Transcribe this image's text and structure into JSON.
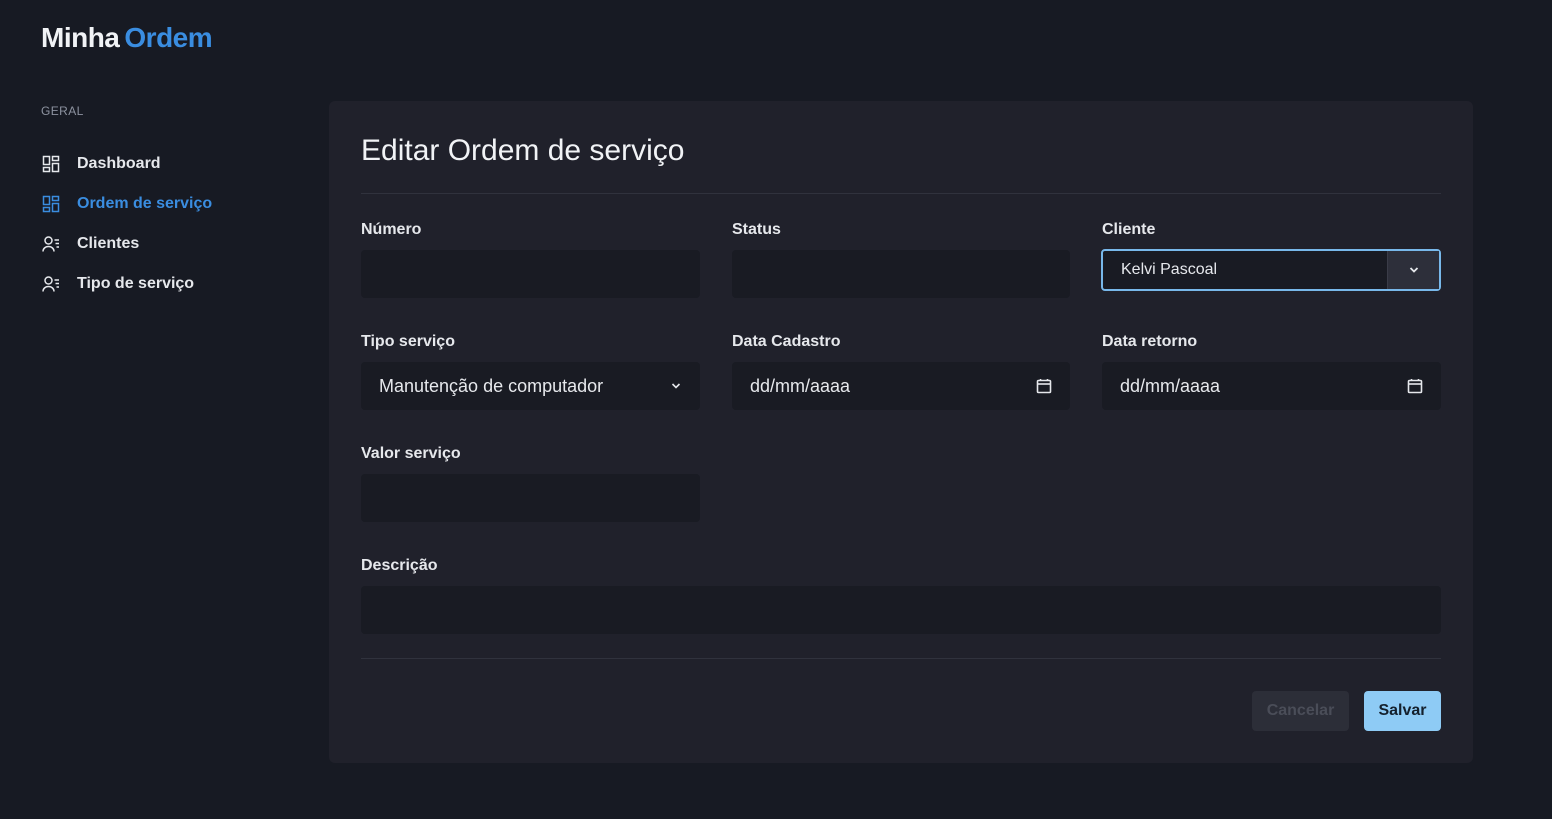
{
  "brand": {
    "part1": "Minha",
    "part2": "Ordem",
    "accent_color": "#3a8de0"
  },
  "sidebar": {
    "section_label": "GERAL",
    "items": [
      {
        "label": "Dashboard",
        "icon": "dashboard-icon",
        "active": false
      },
      {
        "label": "Ordem de serviço",
        "icon": "dashboard-icon",
        "active": true
      },
      {
        "label": "Clientes",
        "icon": "user-list-icon",
        "active": false
      },
      {
        "label": "Tipo de serviço",
        "icon": "user-list-icon",
        "active": false
      }
    ]
  },
  "form": {
    "title": "Editar Ordem de serviço",
    "fields": {
      "numero": {
        "label": "Número",
        "value": ""
      },
      "status": {
        "label": "Status",
        "value": ""
      },
      "cliente": {
        "label": "Cliente",
        "value": "Kelvi Pascoal"
      },
      "tipo_servico": {
        "label": "Tipo serviço",
        "value": "Manutenção de computador"
      },
      "data_cadastro": {
        "label": "Data Cadastro",
        "value": "dd/mm/aaaa"
      },
      "data_retorno": {
        "label": "Data retorno",
        "value": "dd/mm/aaaa"
      },
      "valor_servico": {
        "label": "Valor serviço",
        "value": ""
      },
      "descricao": {
        "label": "Descrição",
        "value": ""
      }
    },
    "buttons": {
      "cancel": "Cancelar",
      "save": "Salvar"
    }
  },
  "colors": {
    "background": "#171a23",
    "card": "#20212b",
    "input": "#191b23",
    "focus_border": "#78b8ea",
    "save_button": "#8ecbf5"
  }
}
